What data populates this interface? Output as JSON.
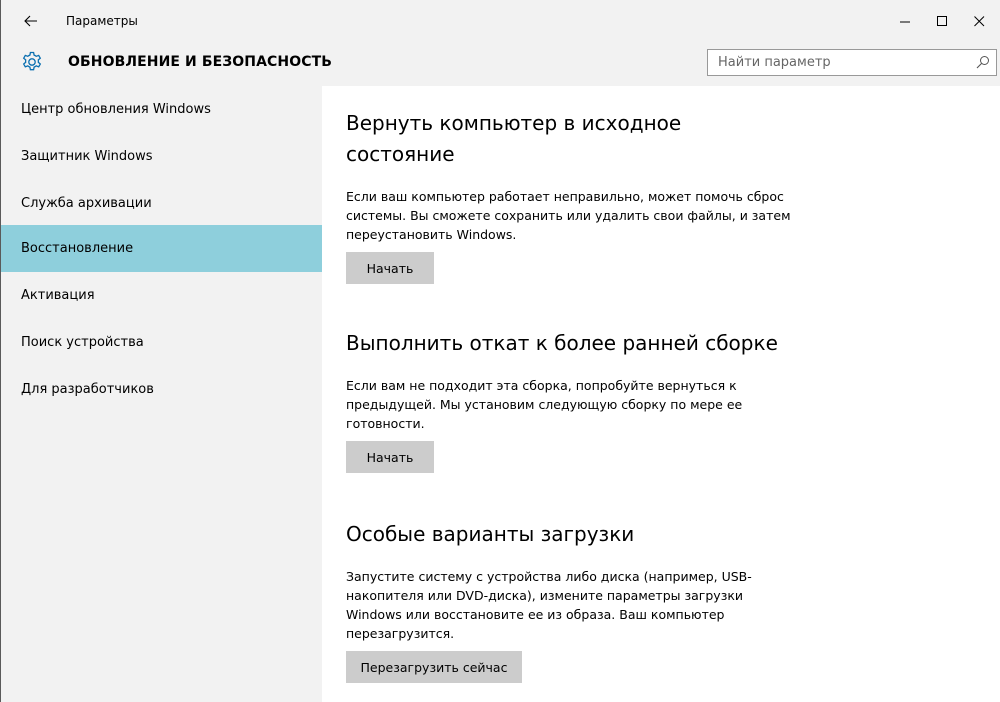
{
  "window": {
    "title": "Параметры",
    "back_icon": "arrow-left-icon",
    "minimize_icon": "minimize-icon",
    "maximize_icon": "maximize-icon",
    "close_icon": "close-icon"
  },
  "header": {
    "icon": "gear-icon",
    "title": "ОБНОВЛЕНИЕ И БЕЗОПАСНОСТЬ",
    "search_placeholder": "Найти параметр",
    "search_value": "",
    "search_icon": "search-icon"
  },
  "sidebar": {
    "items": [
      {
        "label": "Центр обновления Windows",
        "active": false
      },
      {
        "label": "Защитник Windows",
        "active": false
      },
      {
        "label": "Служба архивации",
        "active": false
      },
      {
        "label": "Восстановление",
        "active": true
      },
      {
        "label": "Активация",
        "active": false
      },
      {
        "label": "Поиск устройства",
        "active": false
      },
      {
        "label": "Для разработчиков",
        "active": false
      }
    ]
  },
  "sections": [
    {
      "title": "Вернуть компьютер в исходное состояние",
      "text": "Если ваш компьютер работает неправильно, может помочь сброс системы. Вы сможете сохранить или удалить свои файлы, и затем переустановить Windows.",
      "button": "Начать"
    },
    {
      "title": "Выполнить откат к более ранней сборке",
      "text": "Если вам не подходит эта сборка, попробуйте вернуться к предыдущей. Мы установим следующую сборку по мере ее готовности.",
      "button": "Начать"
    },
    {
      "title": "Особые варианты загрузки",
      "text": "Запустите систему с устройства либо диска (например, USB-накопителя или DVD-диска), измените параметры загрузки Windows или восстановите ее из образа. Ваш компьютер перезагрузится.",
      "button": "Перезагрузить сейчас"
    }
  ],
  "colors": {
    "active_nav": "#8ecfdc",
    "chrome_bg": "#f2f2f2",
    "button_bg": "#cccccc",
    "accent_icon": "#0a6fb0"
  }
}
